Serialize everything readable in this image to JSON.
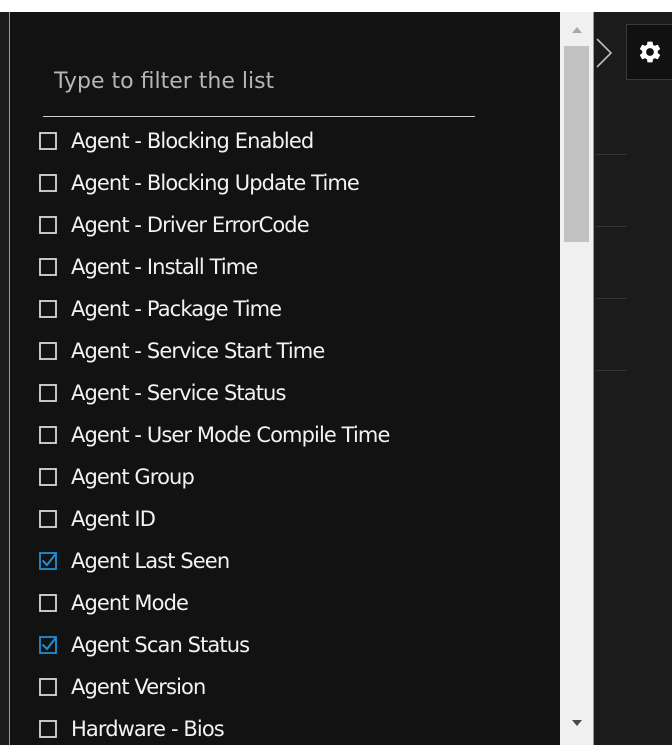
{
  "filter": {
    "placeholder": "Type to filter the list",
    "value": ""
  },
  "options": [
    {
      "label": "Agent - Blocking Enabled",
      "checked": false
    },
    {
      "label": "Agent - Blocking Update Time",
      "checked": false
    },
    {
      "label": "Agent - Driver ErrorCode",
      "checked": false
    },
    {
      "label": "Agent - Install Time",
      "checked": false
    },
    {
      "label": "Agent - Package Time",
      "checked": false
    },
    {
      "label": "Agent - Service Start Time",
      "checked": false
    },
    {
      "label": "Agent - Service Status",
      "checked": false
    },
    {
      "label": "Agent - User Mode Compile Time",
      "checked": false
    },
    {
      "label": "Agent Group",
      "checked": false
    },
    {
      "label": "Agent ID",
      "checked": false
    },
    {
      "label": "Agent Last Seen",
      "checked": true
    },
    {
      "label": "Agent Mode",
      "checked": false
    },
    {
      "label": "Agent Scan Status",
      "checked": true
    },
    {
      "label": "Agent Version",
      "checked": false
    },
    {
      "label": "Hardware - Bios",
      "checked": false
    }
  ],
  "icons": {
    "gear": "gear-icon",
    "expand": "chevron-right-icon",
    "scroll_up": "triangle-up-icon",
    "scroll_down": "triangle-down-icon",
    "checkbox": "checkbox-icon",
    "checkbox_checked": "checkbox-checked-icon"
  },
  "colors": {
    "panel_background": "#121212",
    "text": "#f2f2f2",
    "checkbox_border": "#d9d9d9",
    "check_accent": "#1e8fd6",
    "scrollbar_track": "#f0f0f0",
    "scrollbar_thumb": "#c2c2c2"
  }
}
